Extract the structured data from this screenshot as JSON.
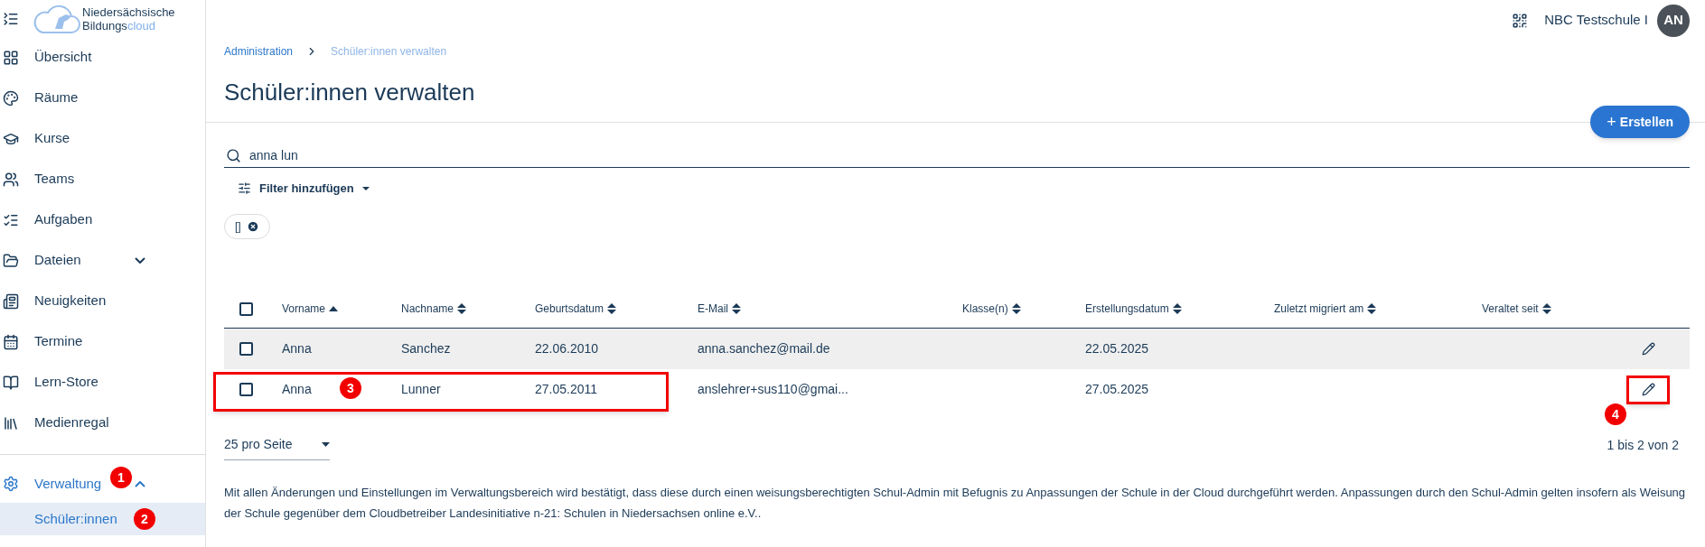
{
  "logo": {
    "line1": "Niedersächsische",
    "line2": "Bildungs",
    "line2_accent": "cloud"
  },
  "sidebar": {
    "items": [
      {
        "label": "Übersicht"
      },
      {
        "label": "Räume"
      },
      {
        "label": "Kurse"
      },
      {
        "label": "Teams"
      },
      {
        "label": "Aufgaben"
      },
      {
        "label": "Dateien",
        "expanded": false
      },
      {
        "label": "Neuigkeiten"
      },
      {
        "label": "Termine"
      },
      {
        "label": "Lern-Store"
      },
      {
        "label": "Medienregal"
      }
    ],
    "admin": {
      "label": "Verwaltung",
      "expanded": true,
      "badge": "1",
      "children": [
        {
          "label": "Schüler:innen",
          "selected": true,
          "badge": "2"
        }
      ]
    }
  },
  "topbar": {
    "school": "NBC Testschule I",
    "avatar": "AN"
  },
  "breadcrumb": [
    {
      "label": "Administration"
    },
    {
      "label": "Schüler:innen verwalten"
    }
  ],
  "title": "Schüler:innen verwalten",
  "create_button": {
    "icon_text": "+",
    "label": "Erstellen"
  },
  "search": {
    "value": "anna lun"
  },
  "filter_button": "Filter hinzufügen",
  "chips": [
    {
      "label": "[]"
    }
  ],
  "table": {
    "select_all": {
      "checked": false
    },
    "columns": [
      {
        "label": "Vorname",
        "sorted": true
      },
      {
        "label": "Nachname",
        "sorted": false
      },
      {
        "label": "Geburtsdatum",
        "sorted": false
      },
      {
        "label": "E-Mail",
        "sorted": false
      },
      {
        "label": "Klasse(n)",
        "sorted": false
      },
      {
        "label": "Erstellungsdatum",
        "sorted": false
      },
      {
        "label": "Zuletzt migriert am",
        "sorted": false
      },
      {
        "label": "Veraltet seit",
        "sorted": false
      }
    ],
    "rows": [
      {
        "checked": false,
        "hovered": true,
        "highlighted": false,
        "edit_highlighted": false,
        "cells": [
          "Anna",
          "Sanchez",
          "22.06.2010",
          "anna.sanchez@mail.de",
          "",
          "22.05.2025",
          "",
          ""
        ]
      },
      {
        "checked": false,
        "hovered": false,
        "highlighted": true,
        "badge": "3",
        "edit_highlighted": true,
        "edit_badge": "4",
        "cells": [
          "Anna",
          "Lunner",
          "27.05.2011",
          "anslehrer+sus110@gmai...",
          "",
          "27.05.2025",
          "",
          ""
        ]
      }
    ]
  },
  "pagination": {
    "per_page": "25 pro Seite",
    "range": "1 bis 2 von 2"
  },
  "footer": "Mit allen Änderungen und Einstellungen im Verwaltungsbereich wird bestätigt, dass diese durch einen weisungsberechtigten Schul-Admin mit Befugnis zu Anpassungen der Schule in der Cloud durchgeführt werden. Anpassungen durch den Schul-Admin gelten insofern als Weisung der Schule gegenüber dem Cloudbetreiber Landesinitiative n-21: Schulen in Niedersachsen online e.V.."
}
